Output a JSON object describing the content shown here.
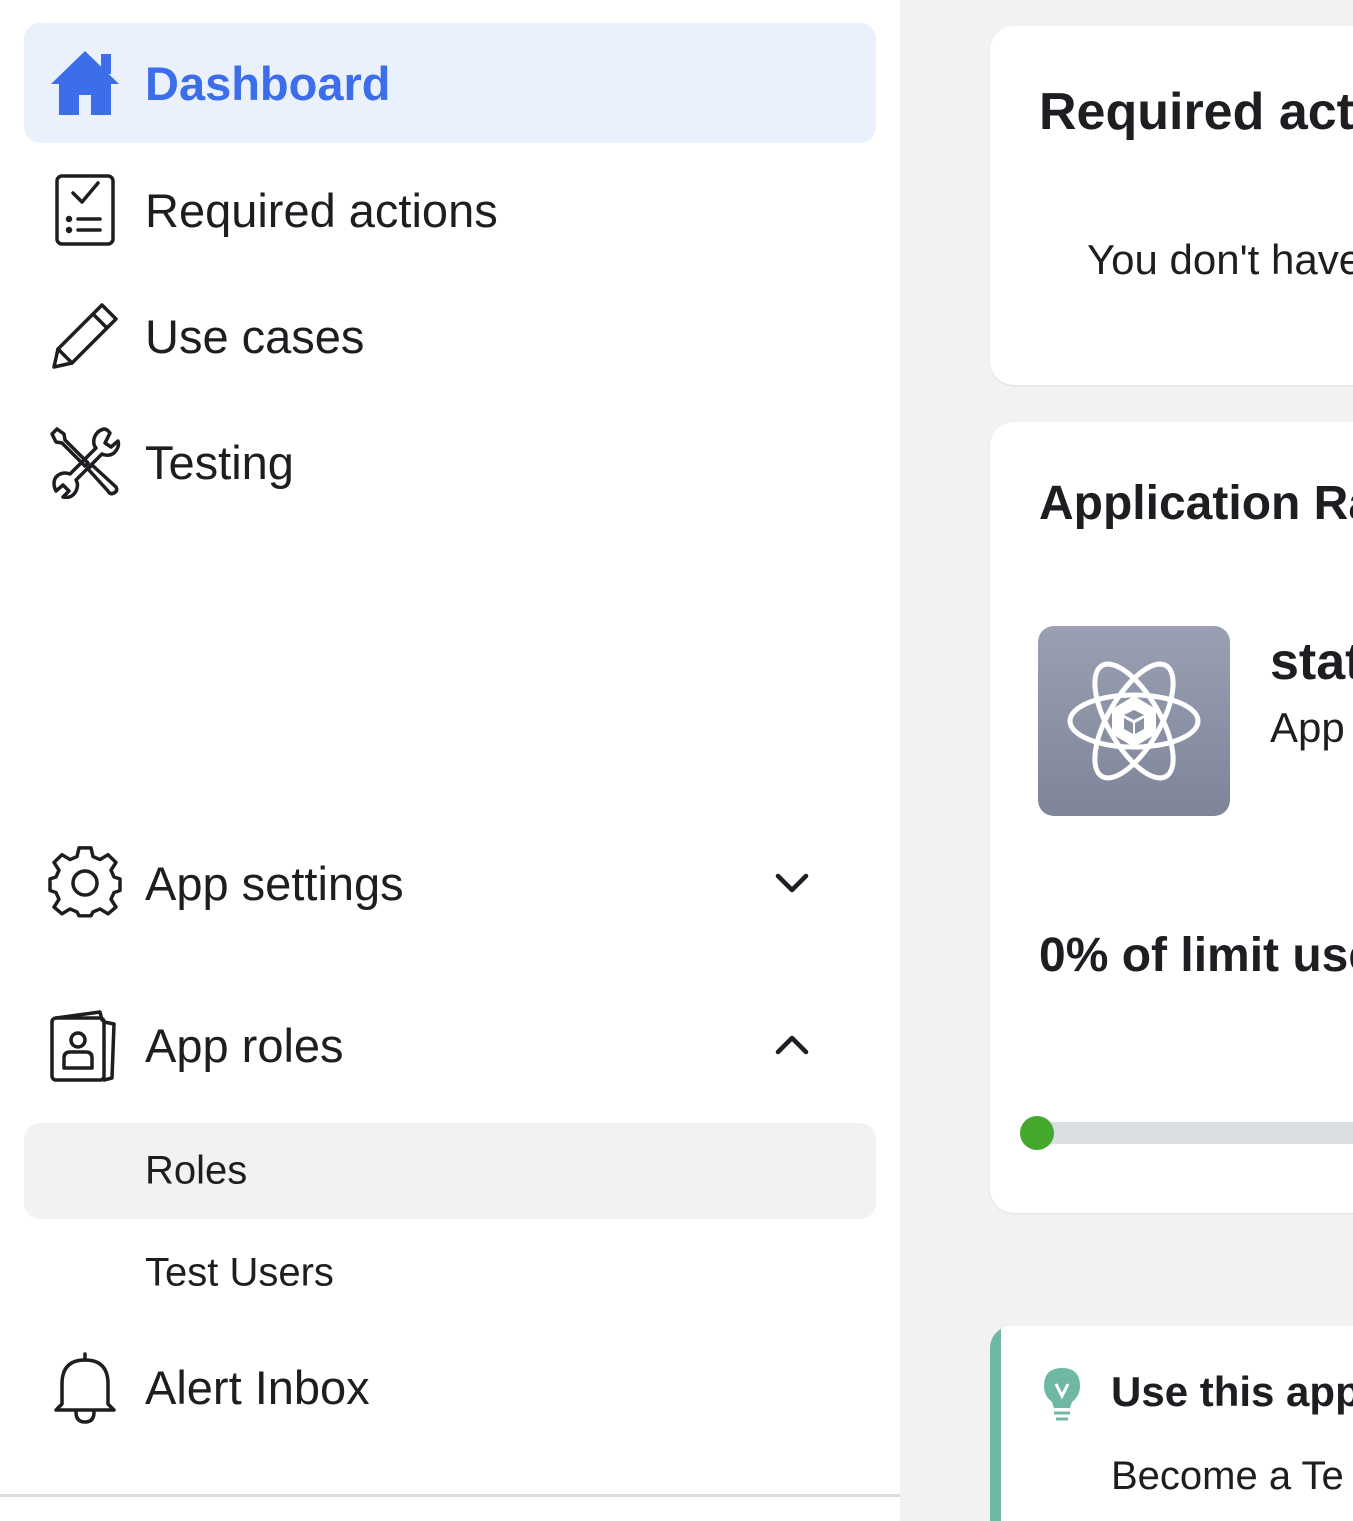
{
  "colors": {
    "accent": "#3b6ee8",
    "active_bg": "#ebf0fd",
    "selected_bg": "#f2f2f2",
    "progress": "#43a82c",
    "tip_accent": "#6fb8a3"
  },
  "sidebar": {
    "items": [
      {
        "label": "Dashboard",
        "icon": "house-icon",
        "active": true
      },
      {
        "label": "Required actions",
        "icon": "checklist-icon"
      },
      {
        "label": "Use cases",
        "icon": "pencil-icon"
      },
      {
        "label": "Testing",
        "icon": "tools-icon"
      },
      {
        "label": "App settings",
        "icon": "gear-icon",
        "expanded": false
      },
      {
        "label": "App roles",
        "icon": "id-badge-icon",
        "expanded": true
      },
      {
        "label": "Alert Inbox",
        "icon": "bell-icon"
      }
    ],
    "app_roles_children": [
      {
        "label": "Roles",
        "selected": true
      },
      {
        "label": "Test Users"
      }
    ]
  },
  "main": {
    "required_actions": {
      "title": "Required acti",
      "message": "You don't have"
    },
    "rate_limit": {
      "title": "Application Ra",
      "app_name": "stat",
      "app_subtitle": "App",
      "usage_label": "0% of limit use",
      "usage_fraction": 0
    },
    "tip": {
      "title": "Use this app",
      "body": "Become a Te",
      "icon": "lightbulb-icon"
    }
  }
}
